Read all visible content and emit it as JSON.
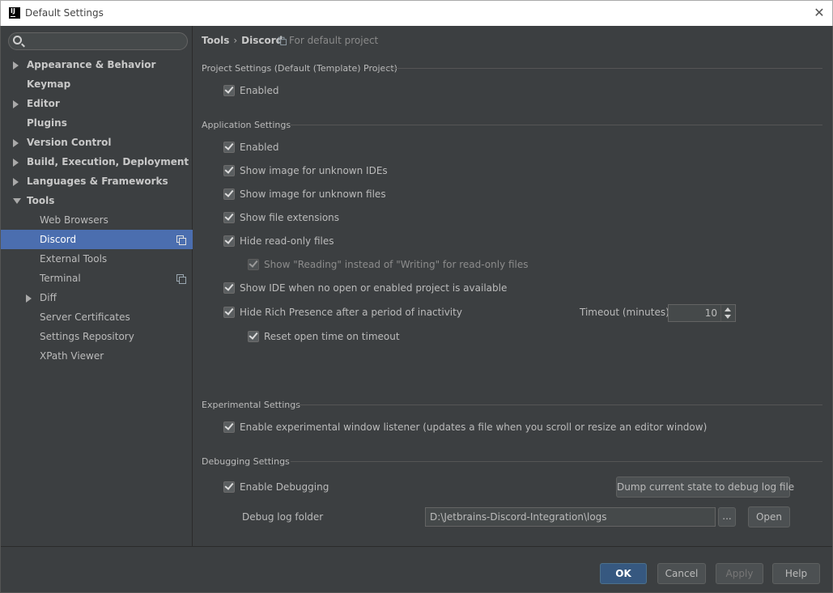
{
  "window": {
    "title": "Default Settings",
    "app_icon_text": "IJ"
  },
  "search": {
    "value": "",
    "placeholder": ""
  },
  "sidebar": {
    "items": [
      {
        "label": "Appearance & Behavior",
        "level": 0,
        "expandable": true,
        "expanded": false
      },
      {
        "label": "Keymap",
        "level": 0,
        "expandable": false
      },
      {
        "label": "Editor",
        "level": 0,
        "expandable": true,
        "expanded": false
      },
      {
        "label": "Plugins",
        "level": 0,
        "expandable": false
      },
      {
        "label": "Version Control",
        "level": 0,
        "expandable": true,
        "expanded": false
      },
      {
        "label": "Build, Execution, Deployment",
        "level": 0,
        "expandable": true,
        "expanded": false
      },
      {
        "label": "Languages & Frameworks",
        "level": 0,
        "expandable": true,
        "expanded": false
      },
      {
        "label": "Tools",
        "level": 0,
        "expandable": true,
        "expanded": true
      },
      {
        "label": "Web Browsers",
        "level": 1
      },
      {
        "label": "Discord",
        "level": 1,
        "selected": true,
        "project_icon": true
      },
      {
        "label": "External Tools",
        "level": 1
      },
      {
        "label": "Terminal",
        "level": 1,
        "project_icon": true
      },
      {
        "label": "Diff",
        "level": 1,
        "expandable": true,
        "expanded": false
      },
      {
        "label": "Server Certificates",
        "level": 1
      },
      {
        "label": "Settings Repository",
        "level": 1
      },
      {
        "label": "XPath Viewer",
        "level": 1
      }
    ]
  },
  "breadcrumb": {
    "parent": "Tools",
    "separator": "›",
    "current": "Discord",
    "scope": "For default project"
  },
  "sections": {
    "project": {
      "title": "Project Settings (Default (Template) Project)",
      "enabled_label": "Enabled"
    },
    "application": {
      "title": "Application Settings",
      "enabled_label": "Enabled",
      "show_image_unknown_ides": "Show image for unknown IDEs",
      "show_image_unknown_files": "Show image for unknown files",
      "show_file_extensions": "Show file extensions",
      "hide_readonly_files": "Hide read-only files",
      "show_reading": "Show \"Reading\" instead of \"Writing\" for read-only files",
      "show_ide_when_no_project": "Show IDE when no open or enabled project is available",
      "hide_rich_presence": "Hide Rich Presence after a period of inactivity",
      "timeout_label": "Timeout (minutes)",
      "timeout_value": "10",
      "reset_open_time": "Reset open time on timeout"
    },
    "experimental": {
      "title": "Experimental Settings",
      "window_listener": "Enable experimental window listener (updates a file when you scroll or resize an editor window)"
    },
    "debugging": {
      "title": "Debugging Settings",
      "enable_debugging": "Enable Debugging",
      "dump_button": "Dump current state to debug log file",
      "log_folder_label": "Debug log folder",
      "log_folder_value": "D:\\Jetbrains-Discord-Integration\\logs",
      "browse_button": "...",
      "open_button": "Open"
    }
  },
  "footer": {
    "ok": "OK",
    "cancel": "Cancel",
    "apply": "Apply",
    "help": "Help"
  },
  "colors": {
    "background": "#3c3f41",
    "selection": "#4b6eaf",
    "primary_button": "#365880"
  }
}
